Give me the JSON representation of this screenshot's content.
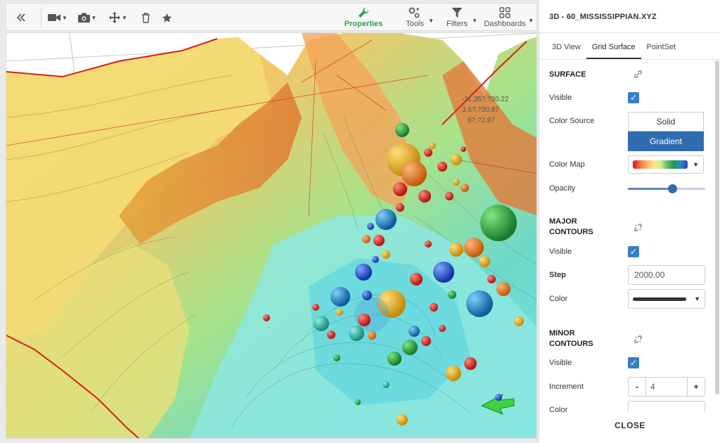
{
  "toolbar": {
    "collapse_icon": "double-chevron-left-icon",
    "camera_icon": "video-camera-icon",
    "snapshot_icon": "camera-icon",
    "move_icon": "move-arrows-icon",
    "trash_icon": "trash-icon",
    "favorite_icon": "star-icon",
    "properties_label": "Properties",
    "tools_label": "Tools",
    "filters_label": "Filters",
    "dashboards_label": "Dashboards",
    "active_color": "#2ea44f"
  },
  "viewport": {
    "coords": {
      "line1": "-11,35?,?30.22",
      "line2": "3,6?,?30.87",
      "line3": "6?,?2.97"
    }
  },
  "panel": {
    "title": "3D - 60_MISSISSIPPIAN.XYZ",
    "tabs": [
      {
        "label": "3D View"
      },
      {
        "label": "Grid Surface"
      },
      {
        "label": "PointSet"
      }
    ],
    "surface": {
      "heading": "SURFACE",
      "visible_label": "Visible",
      "visible": true,
      "color_source_label": "Color Source",
      "option_solid": "Solid",
      "option_gradient": "Gradient",
      "color_map_label": "Color Map",
      "opacity_label": "Opacity",
      "opacity": 0.57
    },
    "major": {
      "heading": "MAJOR CONTOURS",
      "visible_label": "Visible",
      "visible": true,
      "step_label": "Step",
      "step_value": "2000.00",
      "color_label": "Color",
      "color": "#333333"
    },
    "minor": {
      "heading": "MINOR CONTOURS",
      "visible_label": "Visible",
      "visible": true,
      "increment_label": "Increment",
      "increment_value": "4",
      "minus": "-",
      "plus": "+",
      "color_label": "Color"
    },
    "close_label": "CLOSE",
    "accent": "#2f6db0"
  }
}
